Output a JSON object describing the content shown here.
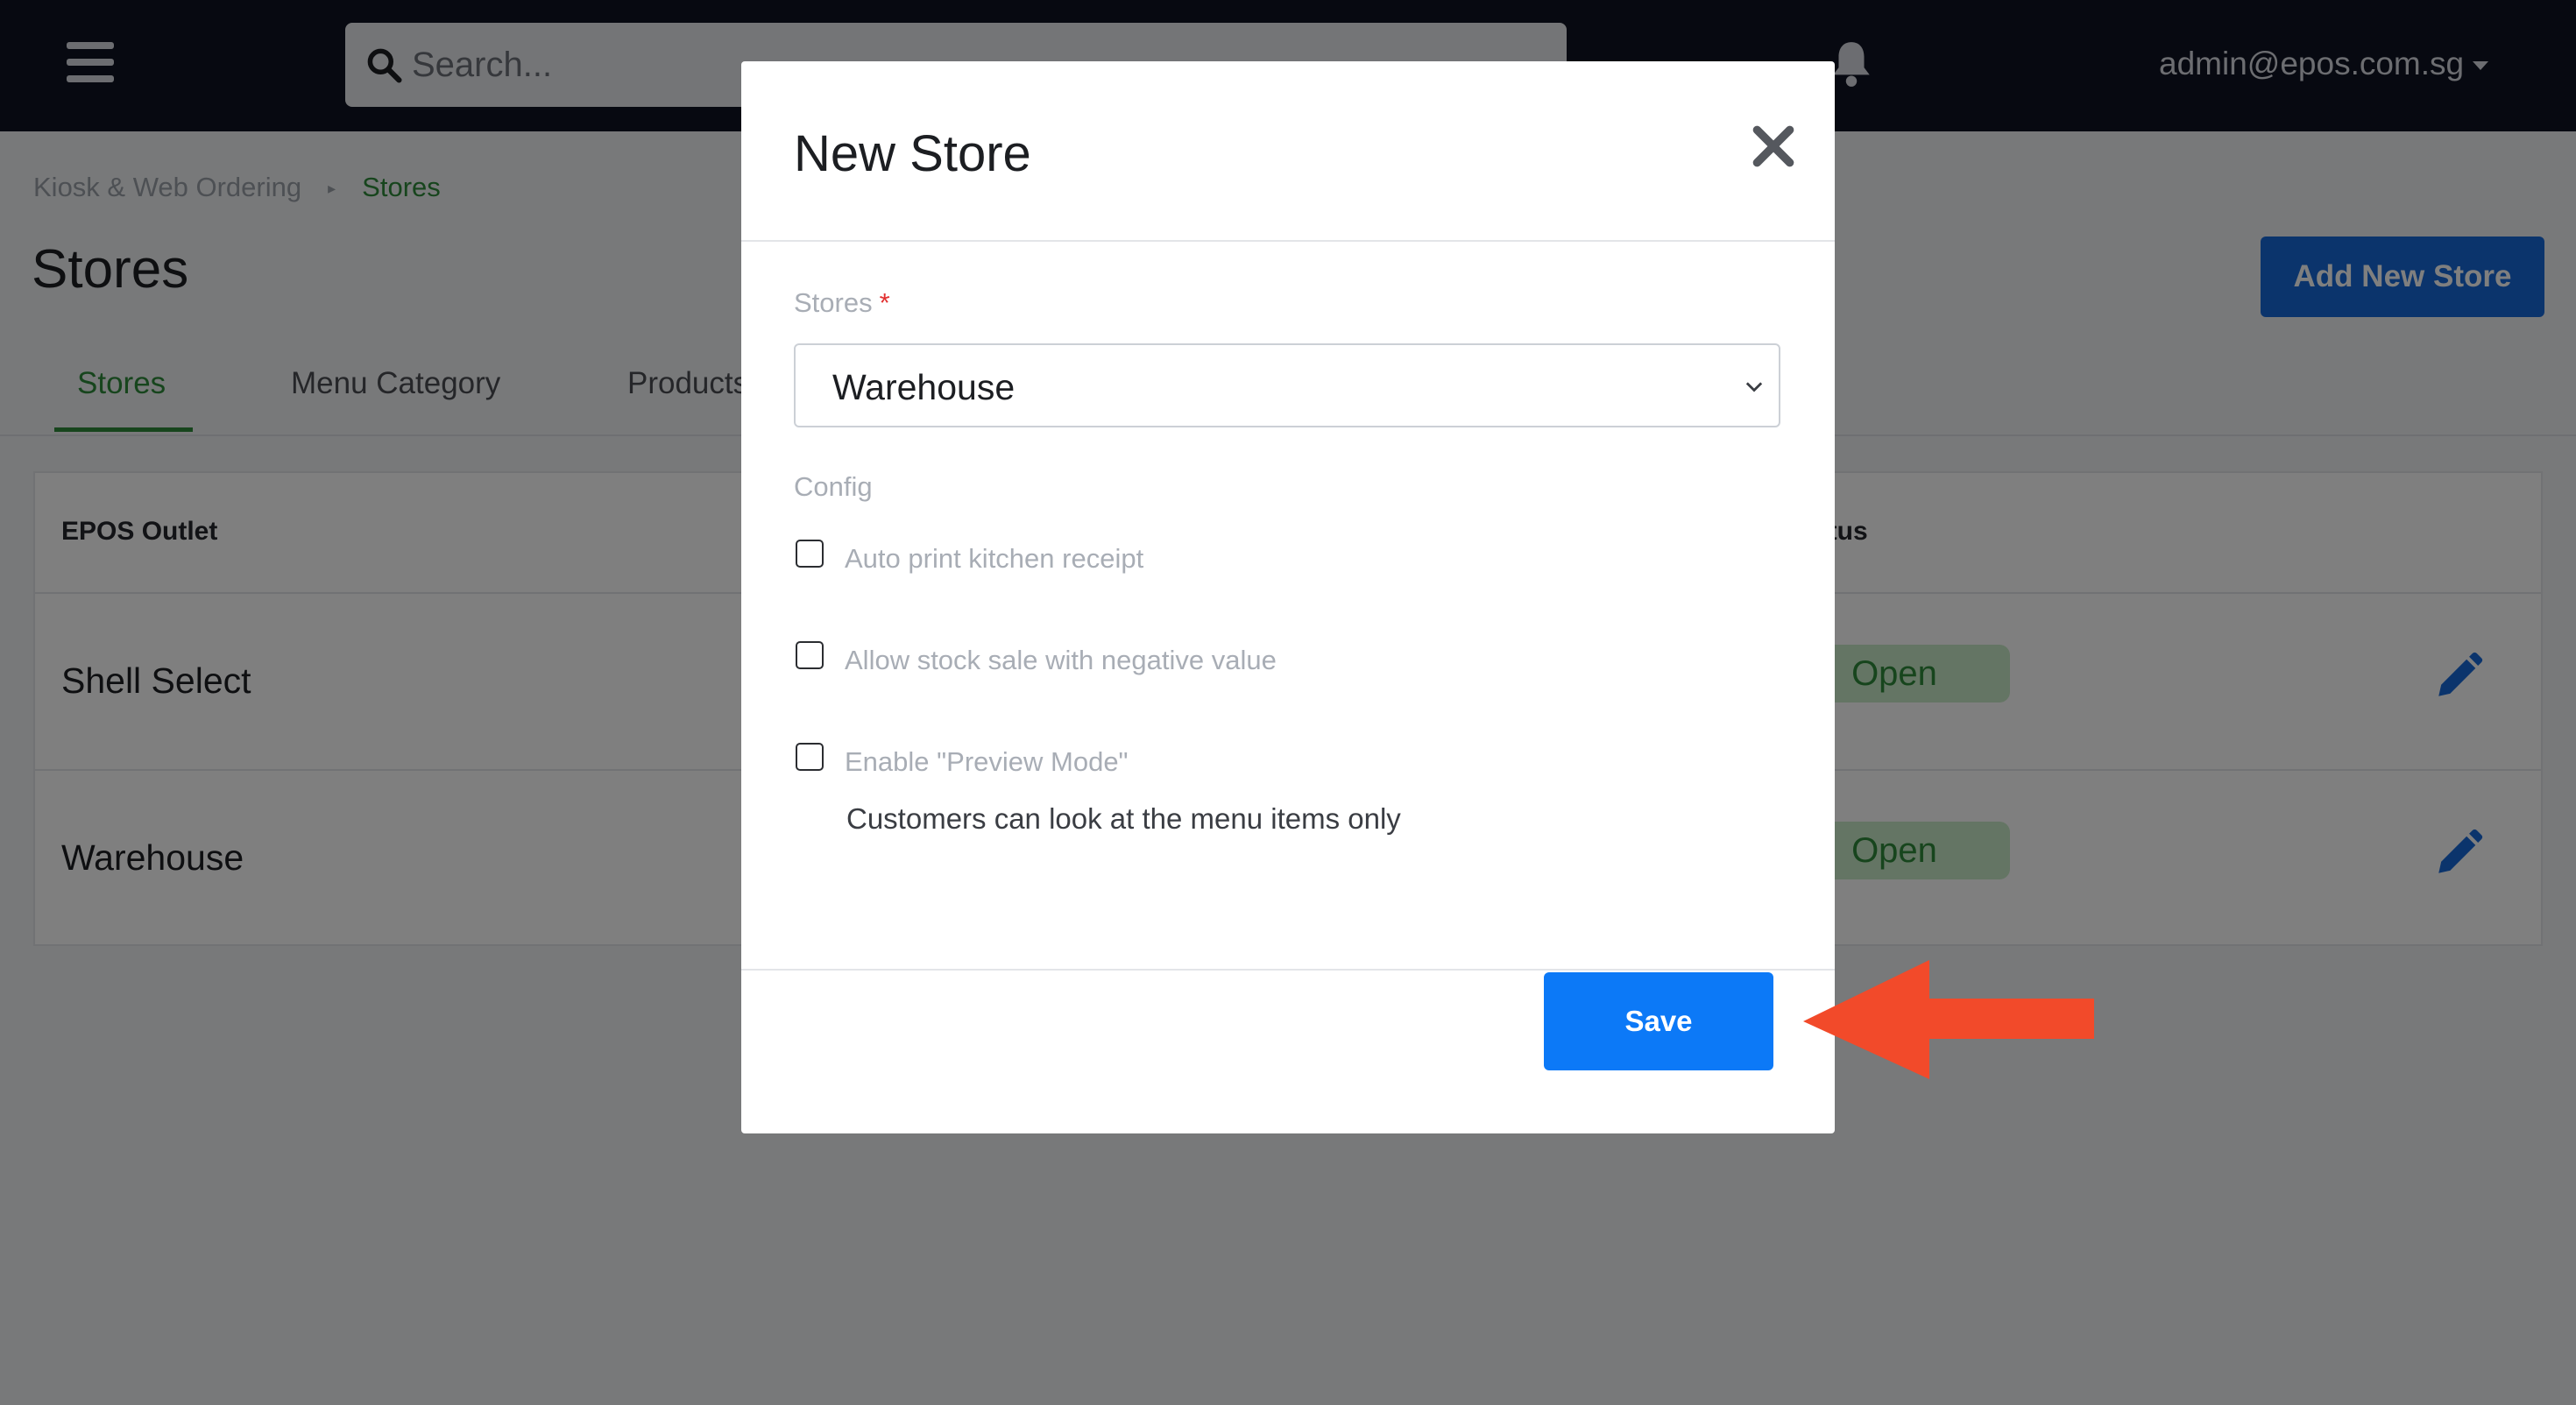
{
  "header": {
    "search": {
      "placeholder": "Search..."
    },
    "user": {
      "email": "admin@epos.com.sg"
    }
  },
  "breadcrumb": {
    "parent": "Kiosk & Web Ordering",
    "current": "Stores"
  },
  "page": {
    "title": "Stores",
    "add_button_label": "Add New Store"
  },
  "tabs": [
    {
      "label": "Stores",
      "active": true
    },
    {
      "label": "Menu Category",
      "active": false
    },
    {
      "label": "Products",
      "active": false
    }
  ],
  "table": {
    "columns": {
      "outlet": "EPOS Outlet",
      "status": "tatus"
    },
    "rows": [
      {
        "outlet": "Shell Select",
        "status": "Open"
      },
      {
        "outlet": "Warehouse",
        "status": "Open"
      }
    ]
  },
  "modal": {
    "title": "New Store",
    "stores_label": "Stores",
    "required_marker": "*",
    "stores_selected": "Warehouse",
    "config_label": "Config",
    "options": [
      {
        "label": "Auto print kitchen receipt",
        "checked": false
      },
      {
        "label": "Allow stock sale with negative value",
        "checked": false
      },
      {
        "label": "Enable \"Preview Mode\"",
        "checked": false
      }
    ],
    "preview_help": "Customers can look at the menu items only",
    "save_label": "Save"
  },
  "colors": {
    "topbar": "#0f1322",
    "accent_green": "#2f8a3b",
    "primary_blue": "#0c79f7",
    "add_button_blue": "#1769d9",
    "status_badge_bg": "#c9eac8",
    "annotation_arrow": "#f24a2a"
  },
  "icons": [
    "hamburger-menu-icon",
    "search-icon",
    "bell-icon",
    "chevron-down-icon",
    "close-icon",
    "pencil-icon",
    "arrow-left-annotation"
  ]
}
